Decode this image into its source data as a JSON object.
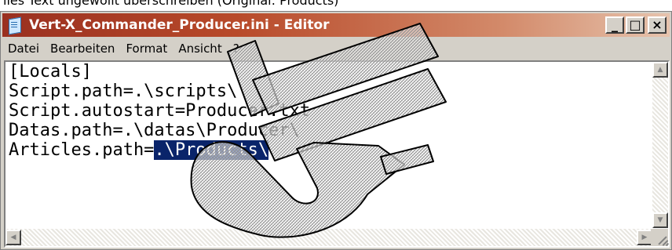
{
  "caption": "lles Text ungewollt überschreiben (Original: Products)",
  "window": {
    "title": "Vert-X_Commander_Producer.ini - Editor",
    "buttons": {
      "minimize": "_",
      "maximize": "□",
      "close": "×"
    }
  },
  "menu": [
    "Datei",
    "Bearbeiten",
    "Format",
    "Ansicht",
    "?"
  ],
  "editor": {
    "lines": [
      "[Locals]",
      "Script.path=.\\scripts\\",
      "Script.autostart=Producer.txt",
      "Datas.path=.\\datas\\Producer\\"
    ],
    "last_line_prefix": "Articles.path=",
    "selected_text": ".\\Products\\"
  },
  "watermark": {
    "kind": "hatched-logo-stamp"
  },
  "scrollbars": {
    "up": "▲",
    "down": "▼",
    "left": "◀",
    "right": "▶"
  }
}
